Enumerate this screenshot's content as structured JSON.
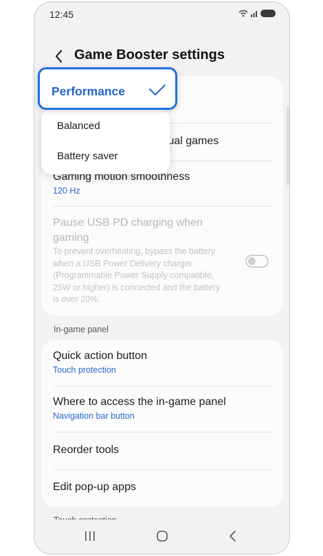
{
  "status_bar": {
    "time": "12:45"
  },
  "header": {
    "title": "Game Booster settings"
  },
  "dropdown": {
    "selected": "Performance",
    "options": [
      "Balanced",
      "Battery saver"
    ]
  },
  "settings_card": {
    "row1_partial_text": "vidual games",
    "motion": {
      "title": "Gaming motion smoothness",
      "value": "120 Hz"
    },
    "usb_pd": {
      "title_line1": "Pause USB PD charging when",
      "title_line2": "gaming",
      "desc_lines": [
        "To prevent overheating, bypass the battery",
        "when a USB Power Delivery charger",
        "(Programmable Power Supply compatible,",
        "25W or higher) is connected and the battery",
        "is over 20%."
      ],
      "enabled": false
    }
  },
  "in_game_panel": {
    "section_label": "In-game panel",
    "quick_action": {
      "title": "Quick action button",
      "value": "Touch protection"
    },
    "access": {
      "title": "Where to access the in-game panel",
      "value": "Navigation bar button"
    },
    "reorder": {
      "title": "Reorder tools"
    },
    "popup": {
      "title": "Edit pop-up apps"
    }
  },
  "next_section": {
    "label": "Touch protection"
  },
  "colors": {
    "accent": "#2563c9",
    "link": "#2d68c8",
    "highlight_border": "#1f6fe0"
  }
}
